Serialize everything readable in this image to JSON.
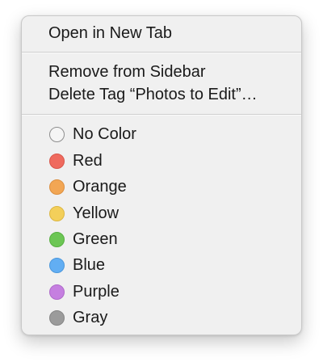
{
  "menu": {
    "items_top": [
      {
        "label": "Open in New Tab"
      }
    ],
    "items_mid": [
      {
        "label": "Remove from Sidebar"
      },
      {
        "label": "Delete Tag “Photos to Edit”…"
      }
    ],
    "tags": [
      {
        "label": "No Color",
        "color": "#f5f5f5",
        "border": "#8e8e8e",
        "icon": "no-color-circle-icon"
      },
      {
        "label": "Red",
        "color": "#ef6a5e",
        "border": "#d8564b",
        "icon": "red-circle-icon"
      },
      {
        "label": "Orange",
        "color": "#f2a654",
        "border": "#dc8f3f",
        "icon": "orange-circle-icon"
      },
      {
        "label": "Yellow",
        "color": "#f3cf5a",
        "border": "#dcb742",
        "icon": "yellow-circle-icon"
      },
      {
        "label": "Green",
        "color": "#6cc654",
        "border": "#56af40",
        "icon": "green-circle-icon"
      },
      {
        "label": "Blue",
        "color": "#62aef3",
        "border": "#4c98dc",
        "icon": "blue-circle-icon"
      },
      {
        "label": "Purple",
        "color": "#c57fe0",
        "border": "#ae69c9",
        "icon": "purple-circle-icon"
      },
      {
        "label": "Gray",
        "color": "#9b9b9b",
        "border": "#858585",
        "icon": "gray-circle-icon"
      }
    ]
  }
}
